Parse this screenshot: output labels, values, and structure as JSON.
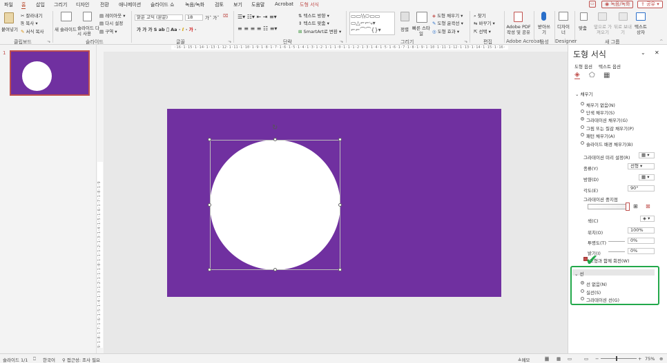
{
  "menu": {
    "items": [
      "파일",
      "홈",
      "삽입",
      "그리기",
      "디자인",
      "전환",
      "애니메이션",
      "슬라이드 쇼",
      "녹음/녹화",
      "검토",
      "보기",
      "도움말",
      "Acrobat"
    ],
    "shape_tab": "도형 서식",
    "record": "녹음/녹화",
    "share": "공유"
  },
  "ribbon": {
    "paste": "붙여넣기",
    "cut": "잘라내기",
    "copy": "복사",
    "format_painter": "서식 복사",
    "clipboard": "클립보드",
    "new_slide": "새 슬라이드",
    "reuse_slide": "슬라이드 다시 사용",
    "layout": "레이아웃",
    "reset": "다시 설정",
    "section": "구역",
    "slides": "슬라이드",
    "font_name": "맑은 고딕 (본문)",
    "font_size": "18",
    "font": "글꼴",
    "text_direction": "텍스트 방향",
    "align_text": "텍스트 맞춤",
    "smartart": "SmartArt로 변환",
    "paragraph": "단락",
    "arrange": "정렬",
    "quick_styles": "빠른 스타일",
    "shape_fill": "도형 채우기",
    "shape_outline": "도형 윤곽선",
    "shape_effects": "도형 효과",
    "drawing": "그리기",
    "find": "찾기",
    "replace": "바꾸기",
    "select": "선택",
    "editing": "편집",
    "adobe_pdf": "Adobe PDF 작성 및 공유",
    "adobe_group": "Adobe Acrobat",
    "dictate": "받아쓰기",
    "voice": "음성",
    "designer": "디자이너",
    "designer_group": "Designer",
    "fit": "맞춤",
    "bring_forward": "앞으로 가져오기",
    "send_backward": "뒤로 보내기",
    "textbox": "텍스트 상자",
    "new_group": "새 그룹"
  },
  "ruler_h": "·16·1·15·1·14·1·13·1·12·1·11·1·10·1·9·1·8·1·7·1·6·1·5·1·4·1·3·1·2·1·1·1·0·1·1·1·2·1·3·1·4·1·5·1·6·1·7·1·8·1·9·1·10·1·11·1·12·1·13·1·14·1·15·1·16·",
  "ruler_v": "9·1·8·1·7·1·6·1·5·1·4·1·3·1·2·1·1·1·0·1·1·1·2·1·3·1·4·1·5·1·6·1·7·1·8·1·9",
  "thumb_number": "1",
  "slide_color": "#7030a0",
  "accent": "#c0504d",
  "pane": {
    "title": "도형 서식",
    "tab_shape": "도형 옵션",
    "tab_text": "텍스트 옵션",
    "fill_header": "채우기",
    "fill_options": [
      "채우기 없음(N)",
      "단색 채우기(S)",
      "그라데이션 채우기(G)",
      "그림 또는 질감 채우기(P)",
      "패턴 채우기(A)",
      "슬라이드 배경 채우기(B)"
    ],
    "preset": "그라데이션 미리 설정(R)",
    "type_label": "종류(Y)",
    "type_value": "선형",
    "direction": "방향(D)",
    "angle_label": "각도(E)",
    "angle_value": "90°",
    "stops": "그라데이션 중지점",
    "color": "색(C)",
    "position": "위치(O)",
    "position_value": "100%",
    "transparency": "투명도(T)",
    "transparency_value": "0%",
    "brightness": "밝기(I)",
    "brightness_value": "0%",
    "rotate_with": "도형과 함께 회전(W)",
    "line_header": "선",
    "line_options": [
      "선 없음(N)",
      "실선(S)",
      "그라데이션 선(G)"
    ]
  },
  "status": {
    "slide": "슬라이드 1/1",
    "language": "한국어",
    "accessibility": "접근성: 조사 필요",
    "notes": "메모",
    "zoom": "75%"
  },
  "highlight_color": "#22a84a"
}
